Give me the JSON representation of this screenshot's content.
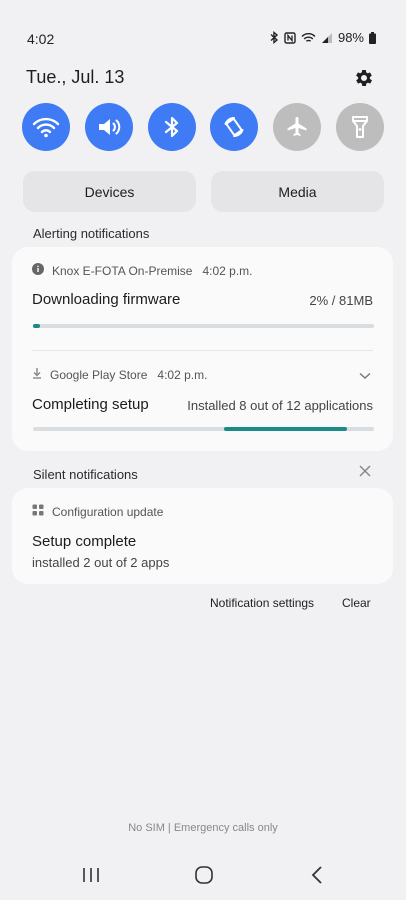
{
  "status_bar": {
    "time": "4:02",
    "battery": "98%",
    "icons": [
      "bluetooth-icon",
      "nfc-icon",
      "wifi-icon",
      "signal-icon",
      "battery-icon"
    ]
  },
  "header": {
    "date": "Tue., Jul. 13"
  },
  "quick_toggles": [
    {
      "name": "wifi",
      "icon": "wifi-icon",
      "state": "on"
    },
    {
      "name": "sound",
      "icon": "volume-icon",
      "state": "on"
    },
    {
      "name": "bluetooth",
      "icon": "bluetooth-icon",
      "state": "on"
    },
    {
      "name": "auto-rotate",
      "icon": "rotate-icon",
      "state": "on"
    },
    {
      "name": "airplane",
      "icon": "airplane-icon",
      "state": "off"
    },
    {
      "name": "flashlight",
      "icon": "flashlight-icon",
      "state": "off"
    }
  ],
  "buttons": {
    "devices": "Devices",
    "media": "Media"
  },
  "alerting": {
    "section_title": "Alerting notifications",
    "notifications": [
      {
        "app": "Knox E-FOTA On-Premise",
        "time": "4:02 p.m.",
        "title": "Downloading firmware",
        "detail": "2% / 81MB",
        "progress": 0.02
      },
      {
        "app": "Google Play Store",
        "time": "4:02 p.m.",
        "title": "Completing setup",
        "detail": "Installed 8 out of 12 applications",
        "progress_segment": [
          0.56,
          0.92
        ]
      }
    ]
  },
  "silent": {
    "section_title": "Silent notifications",
    "notifications": [
      {
        "app": "Configuration update",
        "title": "Setup complete",
        "subtitle": "installed 2 out of 2 apps"
      }
    ]
  },
  "footer_actions": {
    "notification_settings": "Notification settings",
    "clear": "Clear"
  },
  "no_sim_text": "No SIM | Emergency calls only",
  "colors": {
    "accent": "#3e7bf5",
    "toggle_off": "#bdbdbd",
    "progress": "#1d8a8a"
  }
}
